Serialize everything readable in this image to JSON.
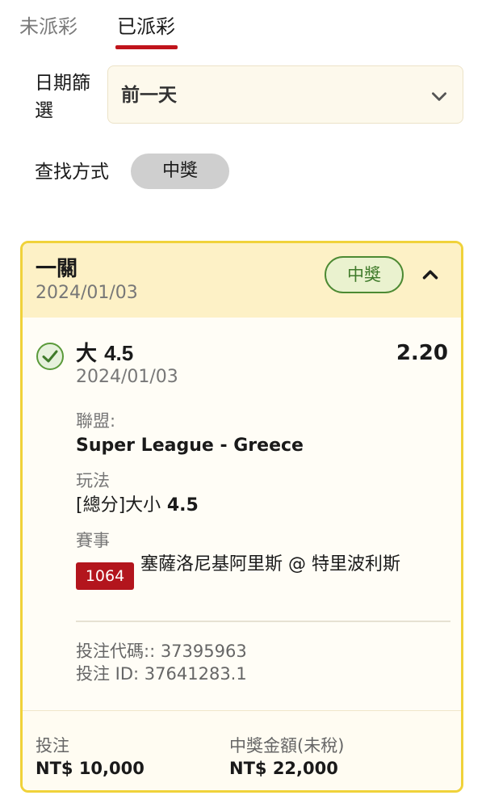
{
  "tabs": {
    "unsettled": "未派彩",
    "settled": "已派彩"
  },
  "filter": {
    "date_label": "日期篩選",
    "date_value": "前一天",
    "search_label": "查找方式",
    "search_chip": "中獎"
  },
  "card": {
    "title": "一關",
    "date": "2024/01/03",
    "status_badge": "中獎",
    "selection": {
      "name_prefix": "大",
      "name_number": "4.5",
      "odds": "2.20",
      "date": "2024/01/03",
      "league_label": "聯盟:",
      "league_value": "Super League - Greece",
      "market_label": "玩法",
      "market_value_prefix": "[總分]大小",
      "market_value_number": "4.5",
      "event_label": "賽事",
      "event_code": "1064",
      "event_name": "塞薩洛尼基阿里斯 @ 特里波利斯"
    },
    "bet_code": "投注代碼:: 37395963",
    "bet_id": "投注 ID: 37641283.1",
    "stake_label": "投注",
    "stake_value": "NT$ 10,000",
    "payout_label": "中獎金額(未稅)",
    "payout_value": "NT$ 22,000"
  },
  "colors": {
    "accent_red": "#c0141b",
    "card_border": "#f0d23a",
    "win_green": "#4d8a33"
  },
  "icons": {
    "dropdown": "chevron-down-icon",
    "collapse": "chevron-up-icon",
    "check": "check-circle-icon"
  }
}
